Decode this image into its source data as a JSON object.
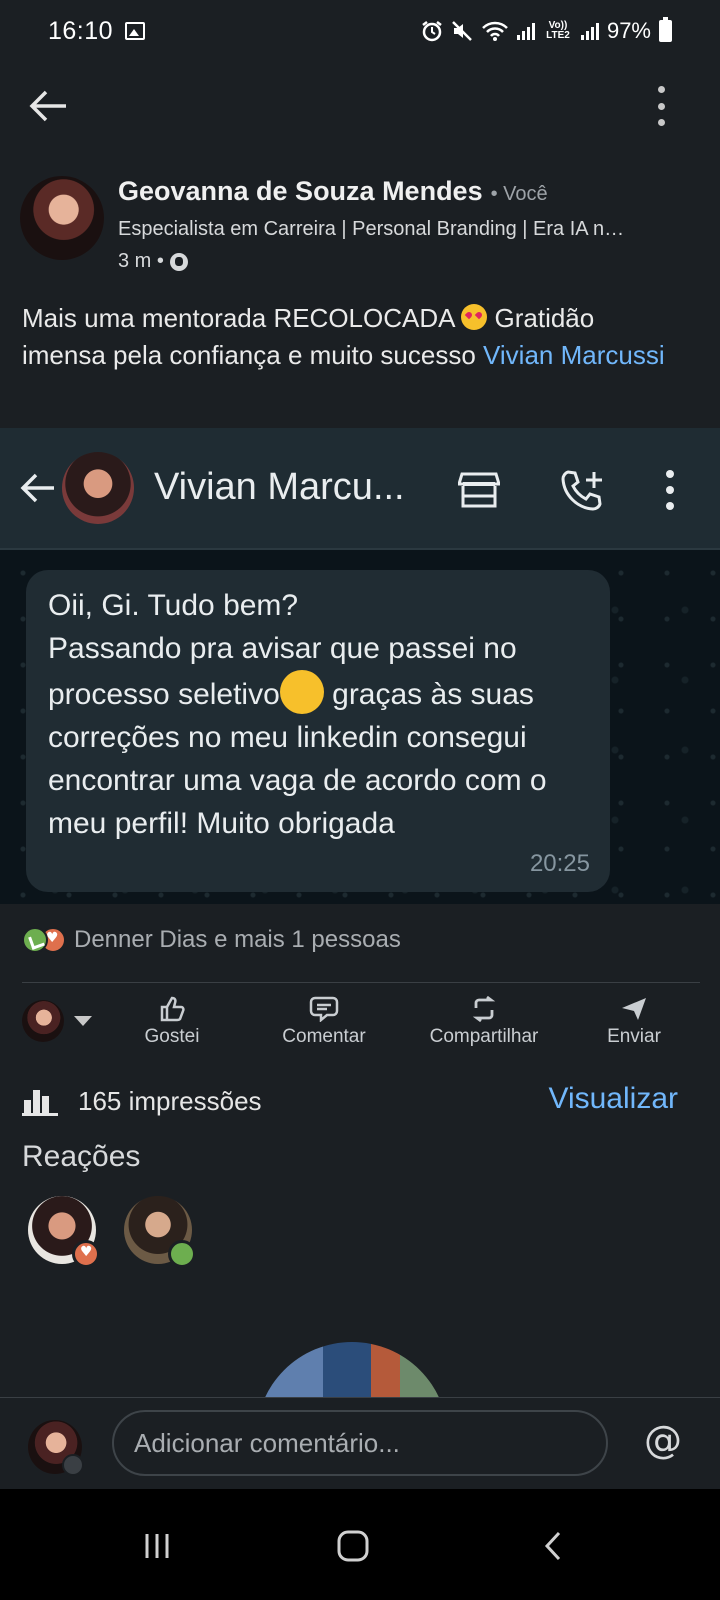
{
  "status_bar": {
    "time": "16:10",
    "lte": "Vo)) LTE2",
    "battery": "97%"
  },
  "author": {
    "name": "Geovanna de Souza Mendes",
    "you_label": "• Você",
    "headline": "Especialista em Carreira | Personal Branding | Era IA n…",
    "meta": "3 m •"
  },
  "post": {
    "text_part1": "Mais uma mentorada RECOLOCADA ",
    "text_part2": " Gratidão imensa pela confiança e muito sucesso ",
    "mention": "Vivian Marcussi"
  },
  "screenshot": {
    "contact_name": "Vivian Marcu...",
    "message_line1": "Oii, Gi. Tudo bem?",
    "message_line2": "Passando pra avisar que passei no processo seletivo",
    "message_line3": " graças às suas correções no meu linkedin consegui encontrar uma vaga de acordo com o meu perfil! Muito obrigada",
    "message_time": "20:25"
  },
  "reactions_summary": "Denner Dias e mais 1 pessoas",
  "actions": {
    "like": "Gostei",
    "comment": "Comentar",
    "share": "Compartilhar",
    "send": "Enviar"
  },
  "impressions": {
    "text": "165 impressões",
    "link": "Visualizar"
  },
  "reactions_title": "Reações",
  "comment_bar": {
    "placeholder": "Adicionar comentário...",
    "at": "@"
  },
  "colors": {
    "background": "#1b1f23",
    "link": "#71b7fb",
    "wa_bubble": "#202c33",
    "wa_header": "#1f2c33"
  }
}
